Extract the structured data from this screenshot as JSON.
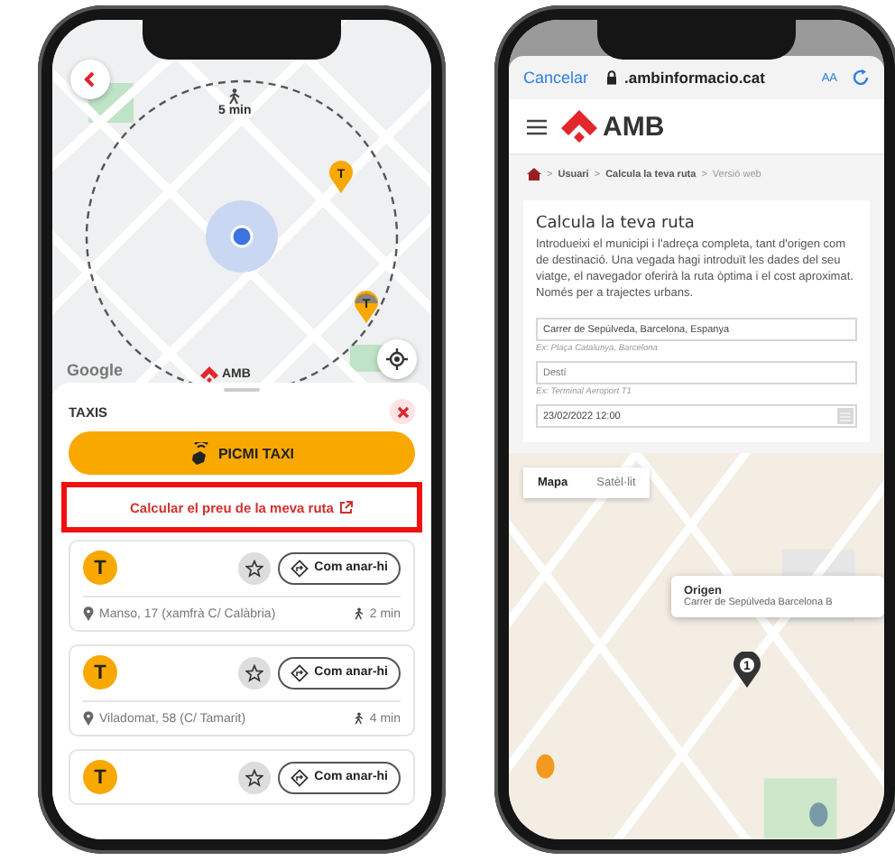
{
  "left_phone": {
    "map": {
      "walk_time": "5 min",
      "attribution": "Google",
      "logo_text": "AMB",
      "taxi_pins": [
        {
          "label": "T",
          "busy": false
        },
        {
          "label": "T",
          "busy": true
        }
      ]
    },
    "sheet": {
      "title": "TAXIS",
      "primary_button": "PICMI TAXI",
      "route_link": {
        "label": "Calcular el preu de la meva ruta",
        "highlighted": true
      },
      "stops": [
        {
          "badge": "T",
          "directions": "Com anar-hi",
          "address": "Manso, 17 (xamfrà C/ Calàbria)",
          "walk_time": "2 min"
        },
        {
          "badge": "T",
          "directions": "Com anar-hi",
          "address": "Viladomat, 58 (C/ Tamarit)",
          "walk_time": "4 min"
        },
        {
          "badge": "T",
          "directions": "Com anar-hi"
        }
      ]
    }
  },
  "right_phone": {
    "browser": {
      "cancel": "Cancelar",
      "url": ".ambinformacio.cat",
      "text_size": "AA"
    },
    "site": {
      "logo_text": "AMB",
      "separator": ">",
      "breadcrumbs": [
        "Usuari",
        "Calcula la teva ruta",
        "Versió web"
      ]
    },
    "form": {
      "title": "Calcula la teva ruta",
      "intro": "Introdueixi el municipi i l'adreça completa, tant d'origen com de destinació. Una vegada hagi introduït les dades del seu viatge, el navegador oferirà la ruta òptima i el cost aproximat. Només per a trajectes urbans.",
      "fields": [
        {
          "kind": "text",
          "value": "Carrer de Sepúlveda, Barcelona, Espanya",
          "hint": "Ex: Plaça Catalunya, Barcelona"
        },
        {
          "kind": "text",
          "placeholder": "Destí",
          "hint": "Ex: Terminal Aeroport T1"
        },
        {
          "kind": "datetime",
          "value": "23/02/2022 12:00"
        }
      ]
    },
    "map": {
      "tabs": [
        {
          "label": "Mapa",
          "selected": true
        },
        {
          "label": "Satèl·lit",
          "selected": false
        }
      ],
      "popup": {
        "title": "Origen",
        "text": "Carrer de Sepúlveda Barcelona B"
      },
      "marker": "1"
    }
  }
}
